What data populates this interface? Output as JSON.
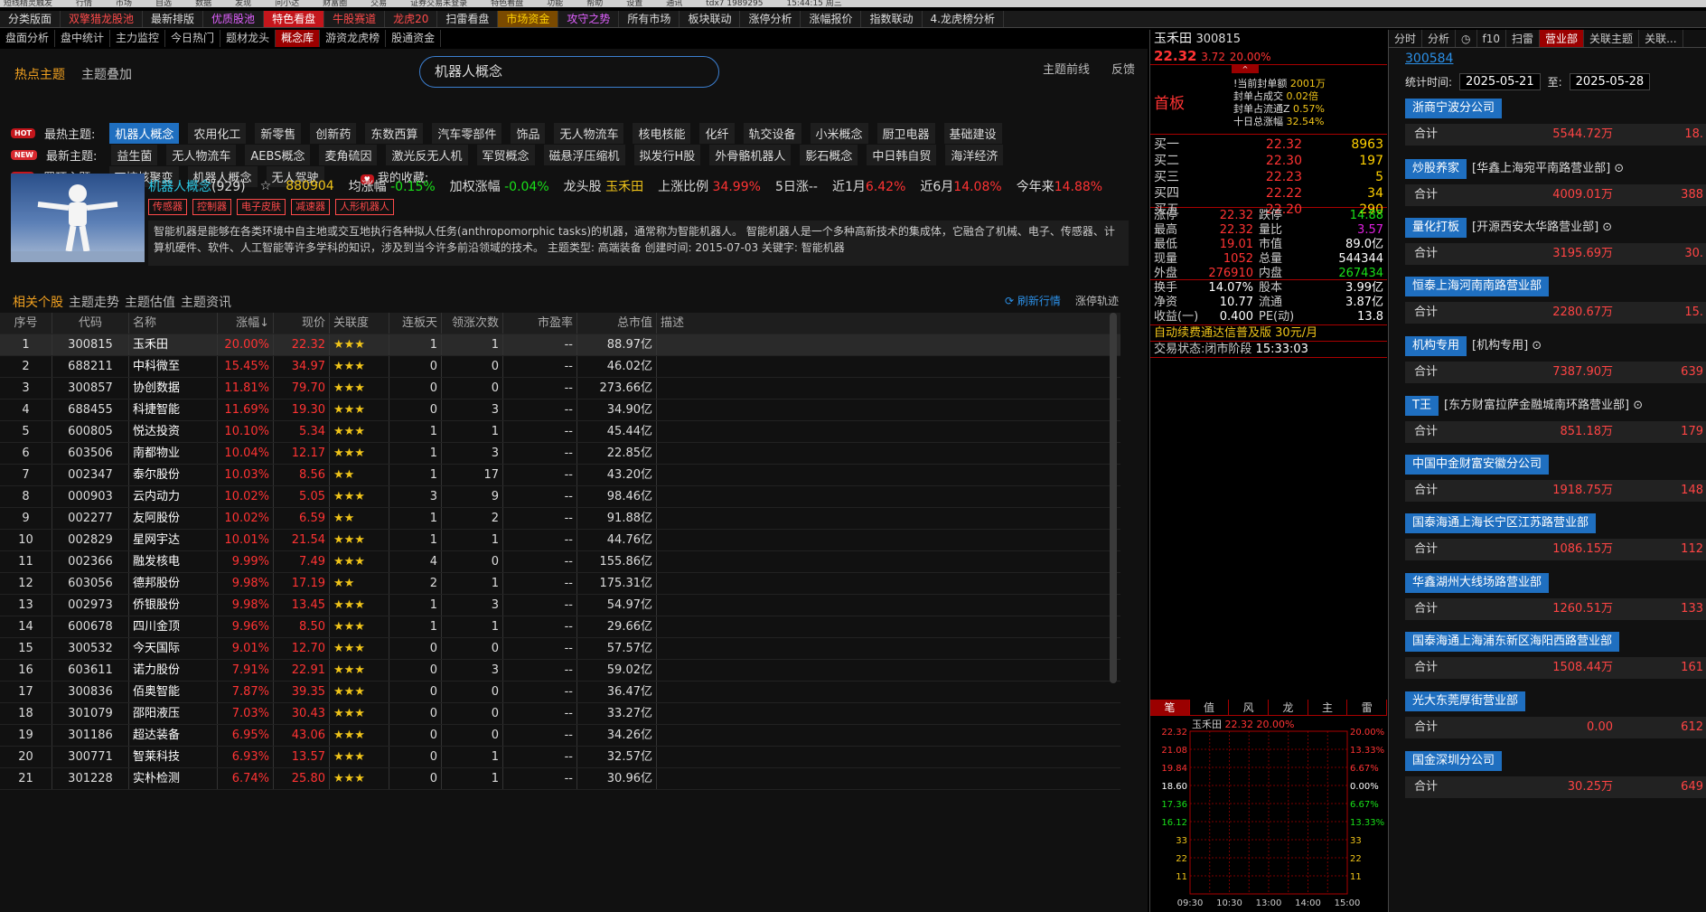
{
  "window": {
    "chrome_items": [
      "短线精灵触发",
      "行情",
      "市场",
      "自选",
      "数据",
      "发现",
      "问小达",
      "财富圈",
      "交易",
      "证券交易未登录",
      "特色看盘",
      "功能",
      "帮助",
      "设置",
      "通讯",
      "tdx7 1989295",
      "15:44:15 周三"
    ]
  },
  "top_tabs": [
    {
      "label": "分类版面",
      "color": "#dddddd",
      "bg": "#1a1a1a"
    },
    {
      "label": "双擎猎龙股池",
      "color": "#ff4a4a",
      "bg": "#1a1a1a"
    },
    {
      "label": "最新排版",
      "color": "#dddddd",
      "bg": "#1a1a1a"
    },
    {
      "label": "优质股池",
      "color": "#e060ff",
      "bg": "#1a1a1a"
    },
    {
      "label": "特色看盘",
      "color": "#ffffff",
      "bg": "#c4161c"
    },
    {
      "label": "牛股赛道",
      "color": "#ff4a4a",
      "bg": "#1a1a1a"
    },
    {
      "label": "龙虎20",
      "color": "#ff4a4a",
      "bg": "#1a1a1a"
    },
    {
      "label": "扫雷看盘",
      "color": "#dddddd",
      "bg": "#1a1a1a"
    },
    {
      "label": "市场资金",
      "color": "#ffd000",
      "bg": "#7a4a00"
    },
    {
      "label": "攻守之势",
      "color": "#e060ff",
      "bg": "#1a1a1a"
    },
    {
      "label": "所有市场",
      "color": "#dddddd",
      "bg": "#1a1a1a"
    },
    {
      "label": "板块联动",
      "color": "#dddddd",
      "bg": "#1a1a1a"
    },
    {
      "label": "涨停分析",
      "color": "#dddddd",
      "bg": "#1a1a1a"
    },
    {
      "label": "涨幅报价",
      "color": "#dddddd",
      "bg": "#1a1a1a"
    },
    {
      "label": "指数联动",
      "color": "#dddddd",
      "bg": "#1a1a1a"
    },
    {
      "label": "4.龙虎榜分析",
      "color": "#dddddd",
      "bg": "#1a1a1a"
    }
  ],
  "sub_tabs": [
    {
      "label": "盘面分析",
      "active": false
    },
    {
      "label": "盘中统计",
      "active": false
    },
    {
      "label": "主力监控",
      "active": false
    },
    {
      "label": "今日热门",
      "active": false
    },
    {
      "label": "题材龙头",
      "active": false
    },
    {
      "label": "概念库",
      "active": true
    },
    {
      "label": "游资龙虎榜",
      "active": false
    },
    {
      "label": "股通资金",
      "active": false
    }
  ],
  "theme": {
    "hot_tab": "热点主题",
    "overlay_tab": "主题叠加",
    "search_value": "机器人概念",
    "frontline": "主题前线",
    "feedback": "反馈"
  },
  "tag_rows": [
    {
      "icon": "HOT",
      "label": "最热主题:",
      "tags": [
        "机器人概念",
        "农用化工",
        "新零售",
        "创新药",
        "东数西算",
        "汽车零部件",
        "饰品",
        "无人物流车",
        "核电核能",
        "化纤",
        "轨交设备",
        "小米概念",
        "厨卫电器",
        "基础建设"
      ],
      "selected": 0
    },
    {
      "icon": "NEW",
      "label": "最新主题:",
      "tags": [
        "益生菌",
        "无人物流车",
        "AEBS概念",
        "麦角硫因",
        "激光反无人机",
        "军贸概念",
        "磁悬浮压缩机",
        "拟发行H股",
        "外骨骼机器人",
        "影石概念",
        "中日韩自贸",
        "海洋经济"
      ],
      "selected": -1
    },
    {
      "icon": "TOP",
      "label": "置顶主题:",
      "tags": [
        "可控核聚变",
        "机器人概念",
        "无人驾驶"
      ],
      "selected": -1,
      "fav": "我的收藏:"
    }
  ],
  "concept": {
    "name": "机器人概念",
    "count": "(929)",
    "star": "☆",
    "code": "880904",
    "avg_label": "均涨幅",
    "avg": "-0.15%",
    "wavg_label": "加权涨幅",
    "wavg": "-0.04%",
    "leader_label": "龙头股",
    "leader": "玉禾田",
    "up_ratio_label": "上涨比例",
    "up_ratio": "34.99%",
    "d5_label": "5日涨",
    "d5": "--",
    "m1_label": "近1月",
    "m1": "6.42%",
    "m6_label": "近6月",
    "m6": "14.08%",
    "ytd_label": "今年来",
    "ytd": "14.88%",
    "tags": [
      "传感器",
      "控制器",
      "电子皮肤",
      "减速器",
      "人形机器人"
    ],
    "desc": "智能机器是能够在各类环境中自主地或交互地执行各种拟人任务(anthropomorphic tasks)的机器，通常称为智能机器人。 智能机器人是一个多种高新技术的集成体，它融合了机械、电子、传感器、计算机硬件、软件、人工智能等许多学科的知识，涉及到当今许多前沿领域的技术。 主题类型: 高端装备  创建时间: 2015-07-03  关键字: 智能机器"
  },
  "list_tabs": {
    "t1": "相关个股",
    "t2": "主题走势",
    "t3": "主题估值",
    "t4": "主题资讯",
    "refresh": "刷新行情",
    "track": "涨停轨迹"
  },
  "table": {
    "headers": [
      "序号",
      "代码",
      "名称",
      "涨幅↓",
      "现价",
      "关联度",
      "连板天",
      "领涨次数",
      "市盈率",
      "总市值",
      "描述"
    ],
    "rows": [
      [
        "1",
        "300815",
        "玉禾田",
        "20.00%",
        "22.32",
        "★★★",
        "1",
        "1",
        "--",
        "88.97亿"
      ],
      [
        "2",
        "688211",
        "中科微至",
        "15.45%",
        "34.97",
        "★★★",
        "0",
        "0",
        "--",
        "46.02亿"
      ],
      [
        "3",
        "300857",
        "协创数据",
        "11.81%",
        "79.70",
        "★★★",
        "0",
        "0",
        "--",
        "273.66亿"
      ],
      [
        "4",
        "688455",
        "科捷智能",
        "11.69%",
        "19.30",
        "★★★",
        "0",
        "3",
        "--",
        "34.90亿"
      ],
      [
        "5",
        "600805",
        "悦达投资",
        "10.10%",
        "5.34",
        "★★★",
        "1",
        "1",
        "--",
        "45.44亿"
      ],
      [
        "6",
        "603506",
        "南都物业",
        "10.04%",
        "12.17",
        "★★★",
        "1",
        "3",
        "--",
        "22.85亿"
      ],
      [
        "7",
        "002347",
        "泰尔股份",
        "10.03%",
        "8.56",
        "★★",
        "1",
        "17",
        "--",
        "43.20亿"
      ],
      [
        "8",
        "000903",
        "云内动力",
        "10.02%",
        "5.05",
        "★★★",
        "3",
        "9",
        "--",
        "98.46亿"
      ],
      [
        "9",
        "002277",
        "友阿股份",
        "10.02%",
        "6.59",
        "★★",
        "1",
        "2",
        "--",
        "91.88亿"
      ],
      [
        "10",
        "002829",
        "星网宇达",
        "10.01%",
        "21.54",
        "★★★",
        "1",
        "1",
        "--",
        "44.76亿"
      ],
      [
        "11",
        "002366",
        "融发核电",
        "9.99%",
        "7.49",
        "★★★",
        "4",
        "0",
        "--",
        "155.86亿"
      ],
      [
        "12",
        "603056",
        "德邦股份",
        "9.98%",
        "17.19",
        "★★",
        "2",
        "1",
        "--",
        "175.31亿"
      ],
      [
        "13",
        "002973",
        "侨银股份",
        "9.98%",
        "13.45",
        "★★★",
        "1",
        "3",
        "--",
        "54.97亿"
      ],
      [
        "14",
        "600678",
        "四川金顶",
        "9.96%",
        "8.50",
        "★★★",
        "1",
        "1",
        "--",
        "29.66亿"
      ],
      [
        "15",
        "300532",
        "今天国际",
        "9.01%",
        "12.70",
        "★★★",
        "0",
        "0",
        "--",
        "57.57亿"
      ],
      [
        "16",
        "603611",
        "诺力股份",
        "7.91%",
        "22.91",
        "★★★",
        "0",
        "3",
        "--",
        "59.02亿"
      ],
      [
        "17",
        "300836",
        "佰奥智能",
        "7.87%",
        "39.35",
        "★★★",
        "0",
        "0",
        "--",
        "36.47亿"
      ],
      [
        "18",
        "301079",
        "邵阳液压",
        "7.03%",
        "30.43",
        "★★★",
        "0",
        "0",
        "--",
        "33.27亿"
      ],
      [
        "19",
        "301186",
        "超达装备",
        "6.95%",
        "43.06",
        "★★★",
        "0",
        "0",
        "--",
        "34.26亿"
      ],
      [
        "20",
        "300771",
        "智莱科技",
        "6.93%",
        "13.57",
        "★★★",
        "0",
        "1",
        "--",
        "32.57亿"
      ],
      [
        "21",
        "301228",
        "实朴检测",
        "6.74%",
        "25.80",
        "★★★",
        "0",
        "1",
        "--",
        "30.96亿"
      ]
    ]
  },
  "stock": {
    "name": "玉禾田",
    "code": "300815",
    "price": "22.32",
    "change": "3.72",
    "pct": "20.00%",
    "status": "首板",
    "seal": [
      {
        "l": "!当前封单额",
        "v": "2001万"
      },
      {
        "l": "封单占成交",
        "v": "0.02倍"
      },
      {
        "l": "封单占流通Z",
        "v": "0.57%"
      },
      {
        "l": "十日总涨幅",
        "v": "32.54%"
      }
    ],
    "book": [
      {
        "l": "买一",
        "p": "22.32",
        "v": "8963"
      },
      {
        "l": "买二",
        "p": "22.30",
        "v": "197"
      },
      {
        "l": "买三",
        "p": "22.23",
        "v": "5"
      },
      {
        "l": "买四",
        "p": "22.22",
        "v": "34"
      },
      {
        "l": "买五",
        "p": "22.20",
        "v": "290"
      }
    ],
    "quotes": [
      [
        "涨停",
        "22.32",
        "跌停",
        "14.88"
      ],
      [
        "最高",
        "22.32",
        "量比",
        "3.57"
      ],
      [
        "最低",
        "19.01",
        "市值",
        "89.0亿"
      ],
      [
        "现量",
        "1052",
        "总量",
        "544344"
      ],
      [
        "外盘",
        "276910",
        "内盘",
        "267434"
      ]
    ],
    "fin": [
      [
        "换手",
        "14.07%",
        "股本",
        "3.99亿"
      ],
      [
        "净资",
        "10.77",
        "流通",
        "3.87亿"
      ],
      [
        "收益(一)",
        "0.400",
        "PE(动)",
        "13.8"
      ]
    ],
    "promo": "自动续费通达信普及版",
    "promo_price": "30元/月",
    "trade_state_label": "交易状态:",
    "trade_state": "闭市阶段",
    "trade_time": "15:33:03"
  },
  "mini": {
    "tabs": [
      "笔",
      "值",
      "风",
      "龙",
      "主",
      "雷"
    ],
    "title": "玉禾田",
    "price": "22.32",
    "pct": "20.00%",
    "left_axis": [
      "22.32",
      "21.08",
      "19.84",
      "18.60",
      "17.36",
      "16.12",
      "33",
      "22",
      "11"
    ],
    "right_axis": [
      "20.00%",
      "13.33%",
      "6.67%",
      "0.00%",
      "6.67%",
      "13.33%",
      "33",
      "22",
      "11"
    ],
    "times": [
      "09:30",
      "10:30",
      "13:00",
      "14:00",
      "15:00"
    ]
  },
  "right_panel": {
    "tabs": [
      {
        "label": "分时",
        "active": false
      },
      {
        "label": "分析",
        "active": false
      },
      {
        "label": "◷",
        "active": false
      },
      {
        "label": "f10",
        "active": false
      },
      {
        "label": "扫雷",
        "active": false
      },
      {
        "label": "营业部",
        "active": true
      },
      {
        "label": "关联主题",
        "active": false
      },
      {
        "label": "关联...",
        "active": false
      }
    ],
    "code": "300584",
    "period_label": "统计时间:",
    "from": "2025-05-21",
    "to_label": "至:",
    "to": "2025-05-28",
    "total_label": "合计",
    "brokers": [
      {
        "name": "浙商宁波分公司",
        "sub": "",
        "v1": "5544.72万",
        "v2": "18."
      },
      {
        "name": "炒股养家",
        "sub": "[华鑫上海宛平南路营业部] ⊙",
        "v1": "4009.01万",
        "v2": "388"
      },
      {
        "name": "量化打板",
        "sub": "[开源西安太华路营业部] ⊙",
        "v1": "3195.69万",
        "v2": "30."
      },
      {
        "name": "恒泰上海河南南路营业部",
        "sub": "",
        "v1": "2280.67万",
        "v2": "15."
      },
      {
        "name": "机构专用",
        "sub": "[机构专用] ⊙",
        "v1": "7387.90万",
        "v2": "639"
      },
      {
        "name": "T王",
        "sub": "[东方财富拉萨金融城南环路营业部] ⊙",
        "v1": "851.18万",
        "v2": "179"
      },
      {
        "name": "中国中金财富安徽分公司",
        "sub": "",
        "v1": "1918.75万",
        "v2": "148"
      },
      {
        "name": "国泰海通上海长宁区江苏路营业部",
        "sub": "",
        "v1": "1086.15万",
        "v2": "112"
      },
      {
        "name": "华鑫湖州大线场路营业部",
        "sub": "",
        "v1": "1260.51万",
        "v2": "133"
      },
      {
        "name": "国泰海通上海浦东新区海阳西路营业部",
        "sub": "",
        "v1": "1508.44万",
        "v2": "161"
      },
      {
        "name": "光大东莞厚街营业部",
        "sub": "",
        "v1": "0.00",
        "v2": "612"
      },
      {
        "name": "国金深圳分公司",
        "sub": "",
        "v1": "30.25万",
        "v2": "649"
      }
    ]
  }
}
